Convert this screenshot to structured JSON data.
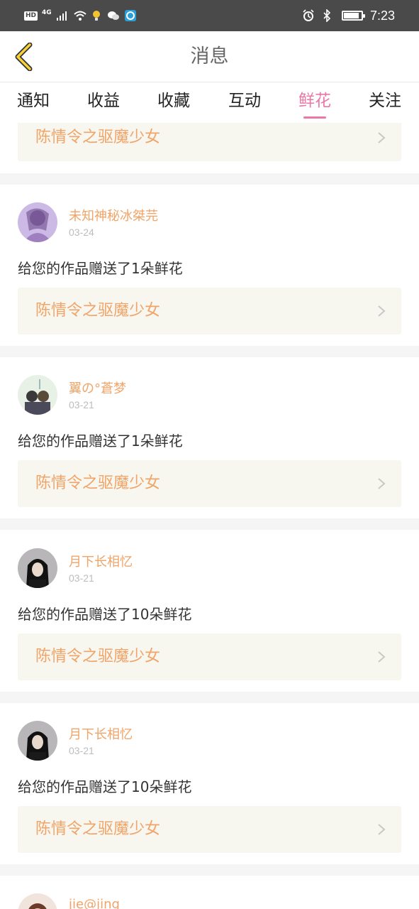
{
  "status_bar": {
    "network_badge": "HD",
    "network_type": "4G",
    "time": "7:23",
    "battery_level": 0.8,
    "icons": [
      "signal-icon",
      "wifi-icon",
      "bulb-icon",
      "wechat-icon",
      "browser-icon",
      "alarm-icon",
      "bluetooth-icon",
      "battery-icon"
    ]
  },
  "header": {
    "title": "消息",
    "back_icon": "chevron-left-icon"
  },
  "tabs": [
    {
      "label": "通知",
      "active": false
    },
    {
      "label": "收益",
      "active": false
    },
    {
      "label": "收藏",
      "active": false
    },
    {
      "label": "互动",
      "active": false
    },
    {
      "label": "鲜花",
      "active": true
    },
    {
      "label": "关注",
      "active": false
    }
  ],
  "colors": {
    "accent_pink": "#e978a6",
    "name_orange": "#f0a468",
    "card_bg": "#f7f6ef"
  },
  "feed": {
    "partial_top_card": {
      "work_title": "陈情令之驱魔少女"
    },
    "items": [
      {
        "username": "未知神秘冰桀芫",
        "date": "03-24",
        "message": "给您的作品赠送了1朵鲜花",
        "work_title": "陈情令之驱魔少女"
      },
      {
        "username": "翼の°蒼梦",
        "date": "03-21",
        "message": "给您的作品赠送了1朵鲜花",
        "work_title": "陈情令之驱魔少女"
      },
      {
        "username": "月下长相忆",
        "date": "03-21",
        "message": "给您的作品赠送了10朵鲜花",
        "work_title": "陈情令之驱魔少女"
      },
      {
        "username": "月下长相忆",
        "date": "03-21",
        "message": "给您的作品赠送了10朵鲜花",
        "work_title": "陈情令之驱魔少女"
      }
    ],
    "partial_bottom_item": {
      "username": "jie@jing"
    }
  }
}
